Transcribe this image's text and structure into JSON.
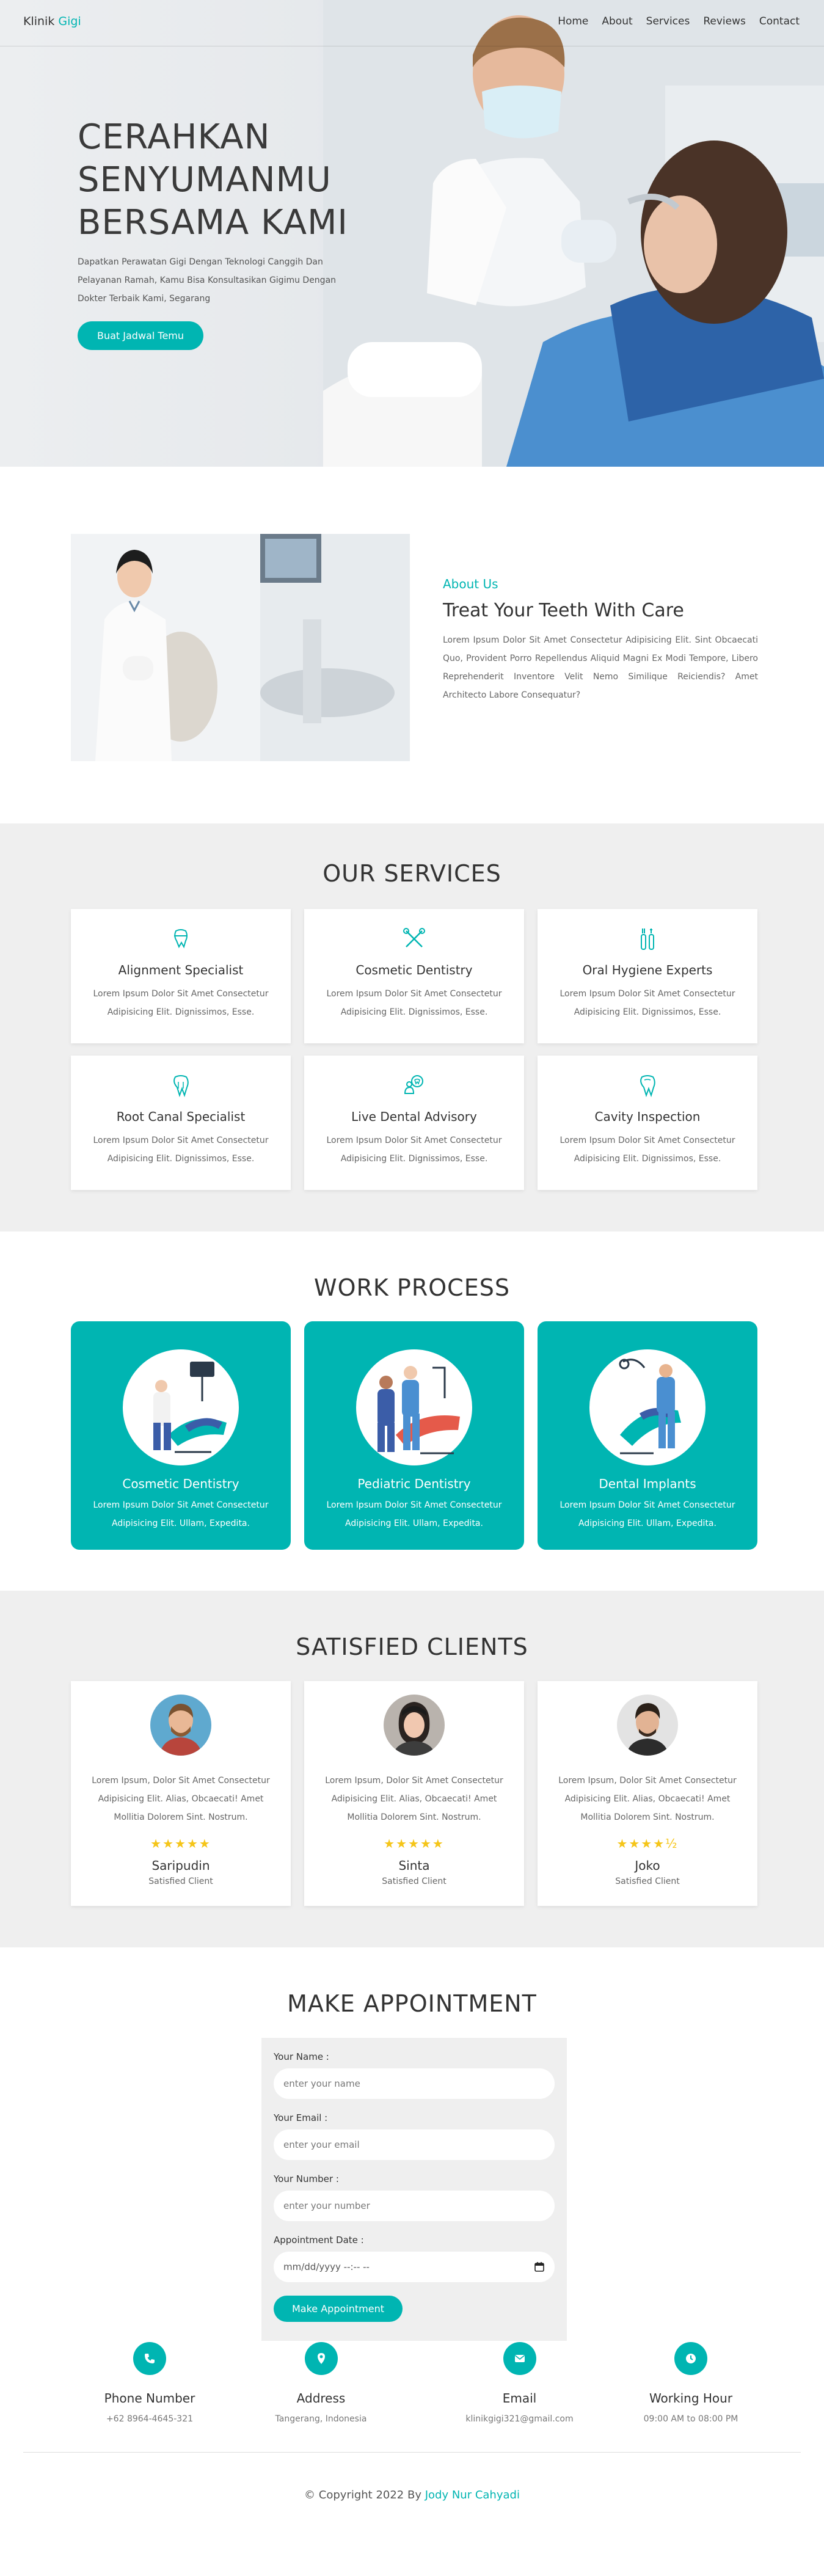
{
  "header": {
    "logo_main": "Klinik",
    "logo_accent": "Gigi",
    "nav": [
      "Home",
      "About",
      "Services",
      "Reviews",
      "Contact"
    ]
  },
  "hero": {
    "title": "CERAHKAN SENYUMANMU BERSAMA KAMI",
    "description": "Dapatkan Perawatan Gigi Dengan Teknologi Canggih Dan Pelayanan Ramah, Kamu Bisa Konsultasikan Gigimu Dengan Dokter Terbaik Kami, Segarang",
    "button": "Buat Jadwal Temu"
  },
  "about": {
    "kicker": "About Us",
    "title": "Treat Your Teeth With Care",
    "description": "Lorem Ipsum Dolor Sit Amet Consectetur Adipisicing Elit. Sint Obcaecati Quo, Provident Porro Repellendus Aliquid Magni Ex Modi Tempore, Libero Reprehenderit Inventore Velit Nemo Similique Reiciendis? Amet Architecto Labore Consequatur?"
  },
  "services": {
    "title": "OUR SERVICES",
    "items": [
      {
        "title": "Alignment Specialist",
        "desc": "Lorem Ipsum Dolor Sit Amet Consectetur Adipisicing Elit. Dignissimos, Esse.",
        "icon": "braces-icon"
      },
      {
        "title": "Cosmetic Dentistry",
        "desc": "Lorem Ipsum Dolor Sit Amet Consectetur Adipisicing Elit. Dignissimos, Esse.",
        "icon": "tools-icon"
      },
      {
        "title": "Oral Hygiene Experts",
        "desc": "Lorem Ipsum Dolor Sit Amet Consectetur Adipisicing Elit. Dignissimos, Esse.",
        "icon": "toothbrush-icon"
      },
      {
        "title": "Root Canal Specialist",
        "desc": "Lorem Ipsum Dolor Sit Amet Consectetur Adipisicing Elit. Dignissimos, Esse.",
        "icon": "tooth-root-icon"
      },
      {
        "title": "Live Dental Advisory",
        "desc": "Lorem Ipsum Dolor Sit Amet Consectetur Adipisicing Elit. Dignissimos, Esse.",
        "icon": "advisory-icon"
      },
      {
        "title": "Cavity Inspection",
        "desc": "Lorem Ipsum Dolor Sit Amet Consectetur Adipisicing Elit. Dignissimos, Esse.",
        "icon": "tooth-icon"
      }
    ]
  },
  "process": {
    "title": "WORK PROCESS",
    "items": [
      {
        "title": "Cosmetic Dentistry",
        "desc": "Lorem Ipsum Dolor Sit Amet Consectetur Adipisicing Elit. Ullam, Expedita."
      },
      {
        "title": "Pediatric Dentistry",
        "desc": "Lorem Ipsum Dolor Sit Amet Consectetur Adipisicing Elit. Ullam, Expedita."
      },
      {
        "title": "Dental Implants",
        "desc": "Lorem Ipsum Dolor Sit Amet Consectetur Adipisicing Elit. Ullam, Expedita."
      }
    ]
  },
  "clients": {
    "title": "SATISFIED CLIENTS",
    "items": [
      {
        "name": "Saripudin",
        "role": "Satisfied Client",
        "desc": "Lorem Ipsum, Dolor Sit Amet Consectetur Adipisicing Elit. Alias, Obcaecati! Amet Mollitia Dolorem Sint. Nostrum.",
        "stars": "★★★★★",
        "rating": 5
      },
      {
        "name": "Sinta",
        "role": "Satisfied Client",
        "desc": "Lorem Ipsum, Dolor Sit Amet Consectetur Adipisicing Elit. Alias, Obcaecati! Amet Mollitia Dolorem Sint. Nostrum.",
        "stars": "★★★★★",
        "rating": 5
      },
      {
        "name": "Joko",
        "role": "Satisfied Client",
        "desc": "Lorem Ipsum, Dolor Sit Amet Consectetur Adipisicing Elit. Alias, Obcaecati! Amet Mollitia Dolorem Sint. Nostrum.",
        "stars": "★★★★½",
        "rating": 4.5
      }
    ]
  },
  "appointment": {
    "title": "MAKE APPOINTMENT",
    "name_label": "Your Name :",
    "name_placeholder": "enter your name",
    "email_label": "Your Email :",
    "email_placeholder": "enter your email",
    "number_label": "Your Number :",
    "number_placeholder": "enter your number",
    "date_label": "Appointment Date :",
    "date_value": "mm/dd/yyyy --:-- --",
    "button": "Make Appointment"
  },
  "contact": [
    {
      "label": "Phone Number",
      "value": "+62 8964-4645-321",
      "icon": "phone-icon"
    },
    {
      "label": "Address",
      "value": "Tangerang, Indonesia",
      "icon": "location-pin-icon"
    },
    {
      "label": "Email",
      "value": "klinikgigi321@gmail.com",
      "icon": "envelope-icon"
    },
    {
      "label": "Working Hour",
      "value": "09:00 AM to 08:00 PM",
      "icon": "clock-icon"
    }
  ],
  "footer": {
    "copyright": "© Copyright 2022 By",
    "author": "Jody Nur Cahyadi"
  },
  "colors": {
    "accent": "#00b5b2",
    "section_gray": "#efefef",
    "star": "#f5c518"
  }
}
